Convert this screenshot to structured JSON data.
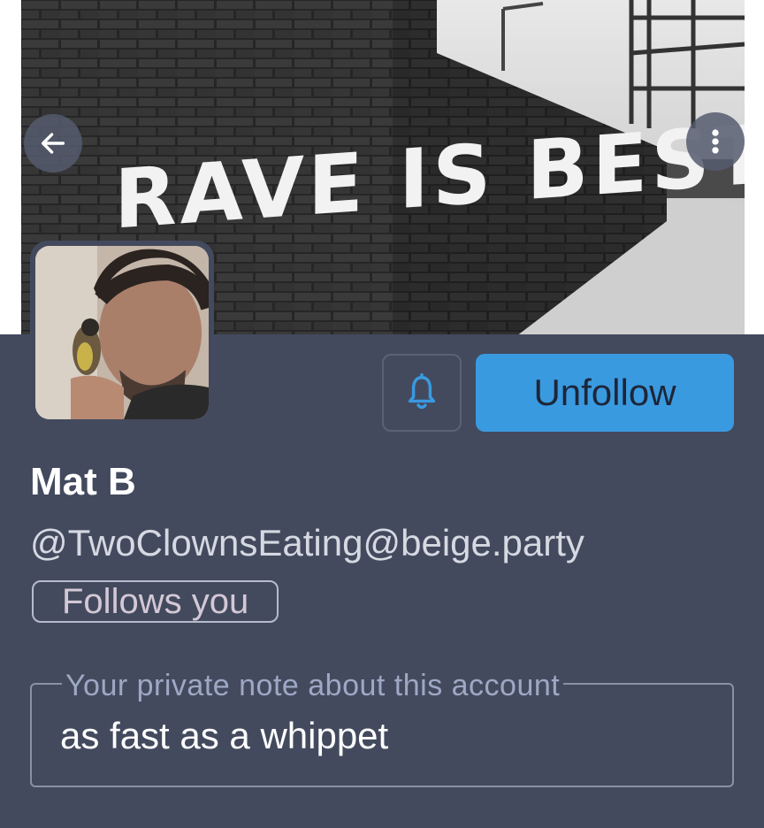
{
  "header": {
    "graffiti_text": "RAVE IS BEST",
    "back_icon": "arrow-left-icon",
    "menu_icon": "more-vertical-icon"
  },
  "profile": {
    "display_name": "Mat B",
    "handle": "@TwoClownsEating@beige.party",
    "follows_you_label": "Follows you"
  },
  "actions": {
    "notify_icon": "bell-icon",
    "unfollow_label": "Unfollow"
  },
  "note": {
    "label": "Your private note about this account",
    "value": "as fast as a whippet"
  },
  "colors": {
    "panel_bg": "#434a5e",
    "accent": "#3a9ae0",
    "badge_text": "#d4c8d6"
  }
}
